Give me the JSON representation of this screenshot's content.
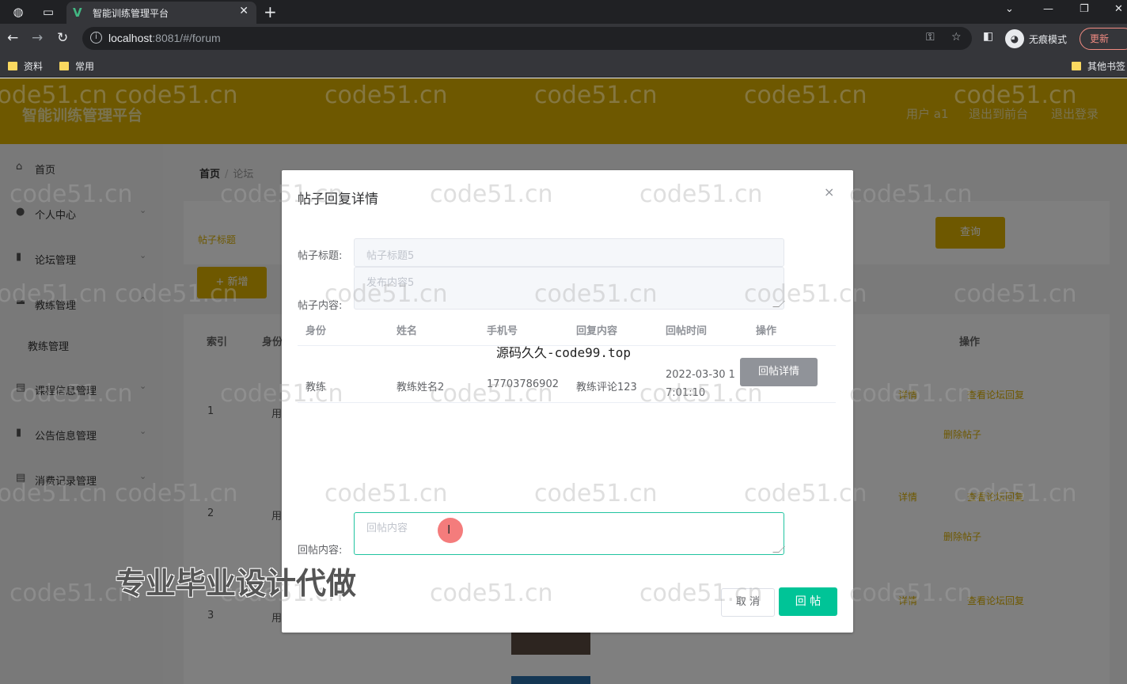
{
  "browser": {
    "tab_title": "智能训练管理平台",
    "tab_logo": "V",
    "url_host": "localhost",
    "url_rest": ":8081/#/forum",
    "incognito_label": "无痕模式",
    "update_label": "更新",
    "bookmarks": [
      {
        "label": "资料"
      },
      {
        "label": "常用"
      },
      {
        "label": "其他书签"
      }
    ]
  },
  "header": {
    "title": "智能训练管理平台",
    "links": [
      "用户 a1",
      "退出到前台",
      "退出登录"
    ]
  },
  "sidebar": {
    "items": [
      {
        "label": "首页",
        "icon": "home-icon"
      },
      {
        "label": "个人中心",
        "icon": "user-icon"
      },
      {
        "label": "论坛管理",
        "icon": "chart-icon"
      },
      {
        "label": "教练管理",
        "icon": "list-icon"
      },
      {
        "label": "课程信息管理",
        "icon": "doc-icon"
      },
      {
        "label": "公告信息管理",
        "icon": "chart-icon"
      },
      {
        "label": "消费记录管理",
        "icon": "doc-icon"
      }
    ],
    "submenu": "教练管理"
  },
  "main": {
    "breadcrumb": {
      "home": "首页",
      "current": "论坛"
    },
    "search_label": "帖子标题",
    "search_button": "查询",
    "add_button": "+ 新增",
    "table_headers": [
      "索引",
      "身份",
      "操作"
    ],
    "rows": [
      {
        "num": "1",
        "user": "用"
      },
      {
        "num": "2",
        "user": "用"
      },
      {
        "num": "3",
        "user": "用"
      }
    ],
    "ops": {
      "detail": "详情",
      "view_reply": "查看论坛回复",
      "delete": "删除帖子"
    }
  },
  "dialog": {
    "title": "帖子回复详情",
    "close": "×",
    "title_label": "帖子标题:",
    "title_value": "帖子标题5",
    "content_label": "帖子内容:",
    "content_value": "发布内容5",
    "reply_table": {
      "headers": [
        "身份",
        "姓名",
        "手机号",
        "回复内容",
        "回帖时间",
        "操作"
      ],
      "rows": [
        {
          "role": "教练",
          "name": "教练姓名2",
          "phone": "17703786902",
          "content": "教练评论123",
          "time_line1": "2022-03-30 1",
          "time_line2": "7:01:10",
          "action": "回帖详情"
        }
      ]
    },
    "reply_label": "回帖内容:",
    "reply_placeholder": "回帖内容",
    "cancel": "取 消",
    "submit": "回 帖"
  },
  "overlays": {
    "watermark": "code51.cn",
    "center_text": "源码久久-code99.top",
    "ad_text": "专业毕业设计代做"
  },
  "colors": {
    "brand_yellow": "#dcb000",
    "primary_green": "#00c497",
    "focus_border": "#20c4a0"
  }
}
